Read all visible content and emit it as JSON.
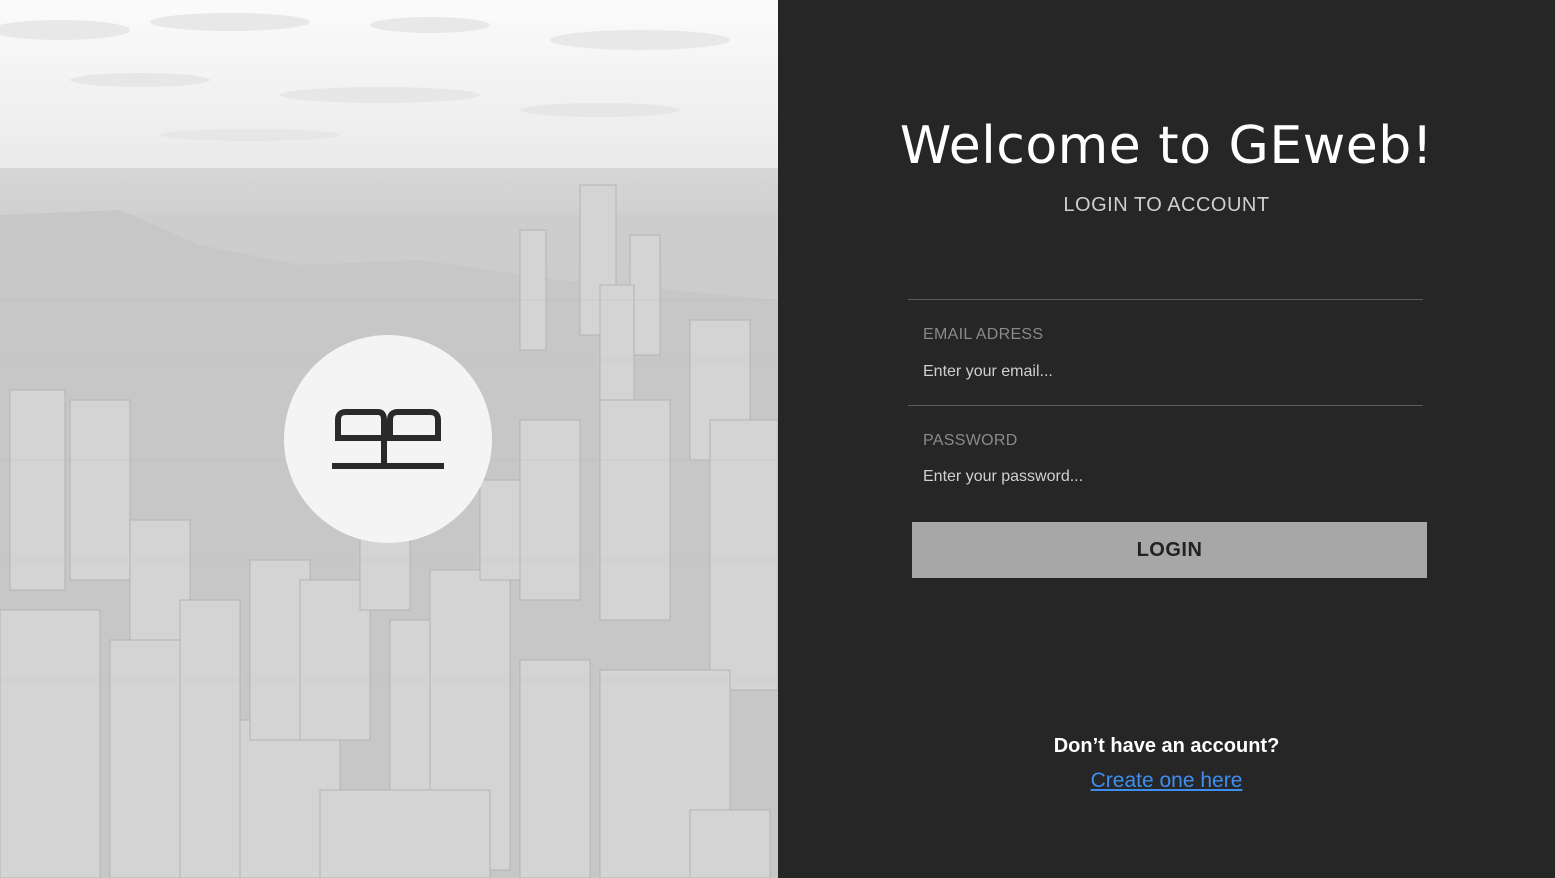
{
  "hero": {
    "logo_icon": "ge-monogram-icon",
    "background": "grayscale-city-skyline"
  },
  "login": {
    "title": "Welcome to GEweb!",
    "subtitle": "LOGIN TO ACCOUNT",
    "email": {
      "label": "EMAIL ADRESS",
      "placeholder": "Enter your email...",
      "value": ""
    },
    "password": {
      "label": "PASSWORD",
      "placeholder": "Enter your password...",
      "value": ""
    },
    "login_button": "LOGIN"
  },
  "signup": {
    "prompt": "Don’t have an account?",
    "link": "Create one here"
  },
  "colors": {
    "panel_bg": "#262626",
    "button_bg": "#a7a7a7",
    "link": "#3d8eef"
  }
}
